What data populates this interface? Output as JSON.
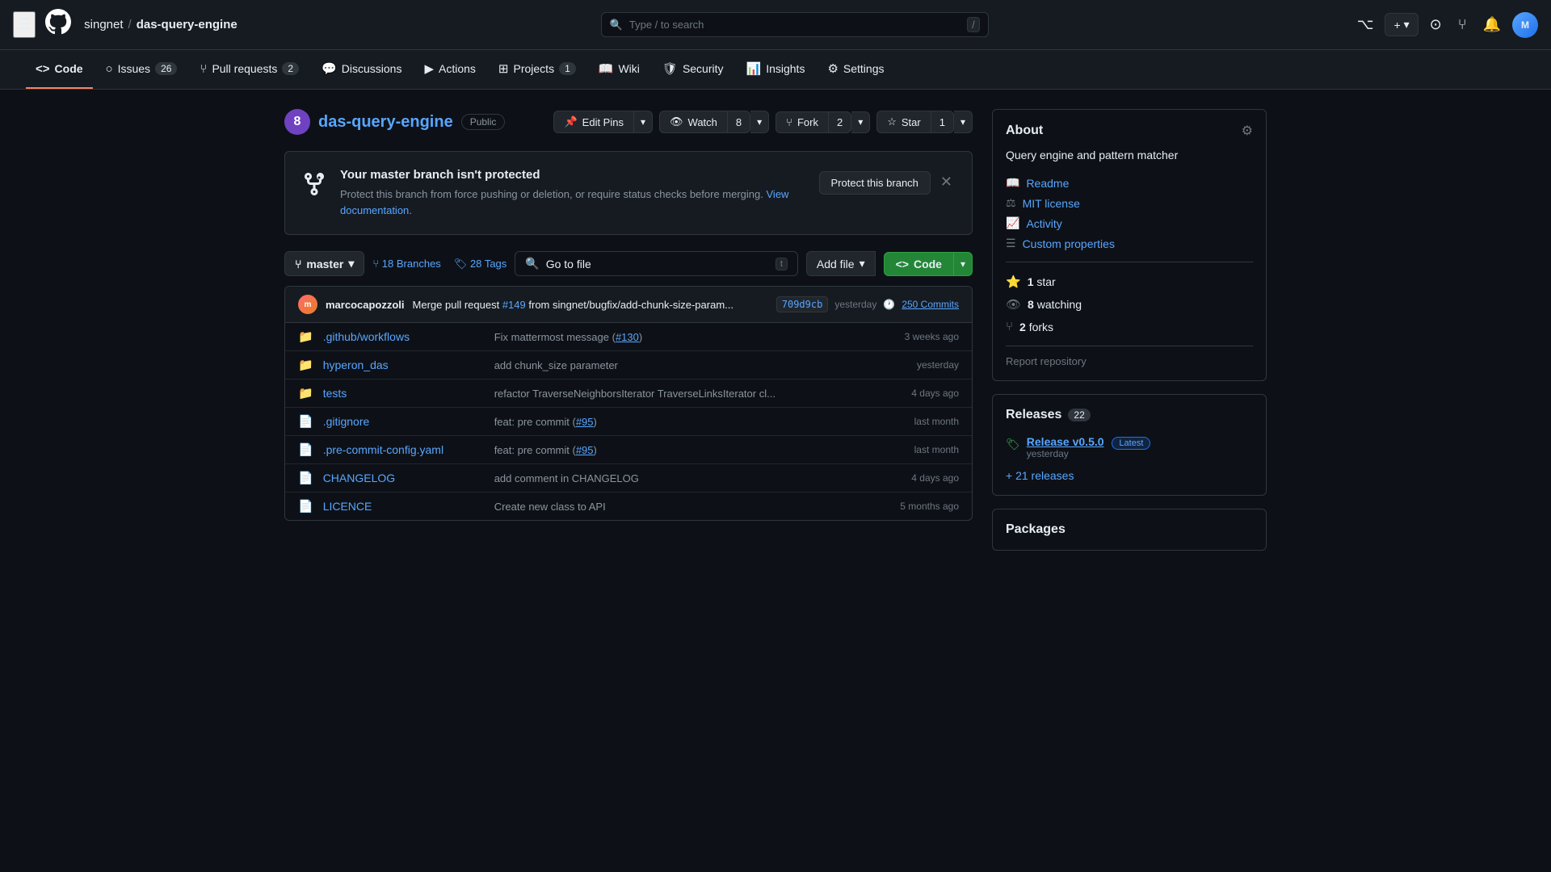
{
  "topnav": {
    "breadcrumb_owner": "singnet",
    "breadcrumb_separator": "/",
    "breadcrumb_repo": "das-query-engine",
    "search_placeholder": "Type / to search",
    "plus_label": "+",
    "plus_dropdown_icon": "▾"
  },
  "repo_tabs": [
    {
      "id": "code",
      "label": "Code",
      "icon": "◁▷",
      "active": true
    },
    {
      "id": "issues",
      "label": "Issues",
      "badge": "26"
    },
    {
      "id": "pull_requests",
      "label": "Pull requests",
      "badge": "2"
    },
    {
      "id": "discussions",
      "label": "Discussions"
    },
    {
      "id": "actions",
      "label": "Actions"
    },
    {
      "id": "projects",
      "label": "Projects",
      "badge": "1"
    },
    {
      "id": "wiki",
      "label": "Wiki"
    },
    {
      "id": "security",
      "label": "Security"
    },
    {
      "id": "insights",
      "label": "Insights"
    },
    {
      "id": "settings",
      "label": "Settings"
    }
  ],
  "repo_header": {
    "icon_letter": "8",
    "repo_name": "das-query-engine",
    "visibility": "Public",
    "edit_pins_label": "Edit Pins",
    "watch_label": "Watch",
    "watch_count": "8",
    "fork_label": "Fork",
    "fork_count": "2",
    "star_label": "Star",
    "star_count": "1"
  },
  "protection_banner": {
    "title": "Your master branch isn't protected",
    "description": "Protect this branch from force pushing or deletion, or require status checks before merging.",
    "link_text": "View documentation.",
    "protect_button": "Protect this branch"
  },
  "file_browser": {
    "branch": "master",
    "branches_count": "18",
    "branches_label": "Branches",
    "tags_count": "28",
    "tags_label": "Tags",
    "go_to_file": "Go to file",
    "go_to_file_kbd": "t",
    "add_file_label": "Add file",
    "code_label": "Code",
    "commit": {
      "author": "marcocapozzoli",
      "message": "Merge pull request",
      "pr_number": "#149",
      "pr_suffix": "from singnet/bugfix/add-chunk-size-param...",
      "hash": "709d9cb",
      "time": "yesterday",
      "total_commits": "250 Commits"
    },
    "files": [
      {
        "type": "folder",
        "name": ".github/workflows",
        "commit_msg": "Fix mattermost message (",
        "commit_link": "#130",
        "commit_link_suffix": ")",
        "time": "3 weeks ago"
      },
      {
        "type": "folder",
        "name": "hyperon_das",
        "commit_msg": "add chunk_size parameter",
        "time": "yesterday"
      },
      {
        "type": "folder",
        "name": "tests",
        "commit_msg": "refactor TraverseNeighborsIterator TraverseLinksIterator cl...",
        "time": "4 days ago"
      },
      {
        "type": "file",
        "name": ".gitignore",
        "commit_msg": "feat: pre commit (",
        "commit_link": "#95",
        "commit_link_suffix": ")",
        "time": "last month"
      },
      {
        "type": "file",
        "name": ".pre-commit-config.yaml",
        "commit_msg": "feat: pre commit (",
        "commit_link": "#95",
        "commit_link_suffix": ")",
        "time": "last month"
      },
      {
        "type": "file",
        "name": "CHANGELOG",
        "commit_msg": "add comment in CHANGELOG",
        "time": "4 days ago"
      },
      {
        "type": "file",
        "name": "LICENCE",
        "commit_msg": "Create new class to API",
        "time": "5 months ago"
      }
    ]
  },
  "about": {
    "title": "About",
    "description": "Query engine and pattern matcher",
    "links": [
      {
        "label": "Readme",
        "icon": "📖"
      },
      {
        "label": "MIT license",
        "icon": "⚖"
      },
      {
        "label": "Activity",
        "icon": "📈"
      },
      {
        "label": "Custom properties",
        "icon": "☰"
      }
    ],
    "stats": [
      {
        "icon": "⭐",
        "label": "1 star"
      },
      {
        "icon": "👁",
        "label": "8 watching"
      },
      {
        "icon": "⑂",
        "label": "2 forks"
      }
    ],
    "report": "Report repository"
  },
  "releases": {
    "title": "Releases",
    "count": "22",
    "latest": {
      "name": "Release v0.5.0",
      "badge": "Latest",
      "date": "yesterday"
    },
    "more_text": "+ 21 releases"
  },
  "packages": {
    "title": "Packages"
  }
}
